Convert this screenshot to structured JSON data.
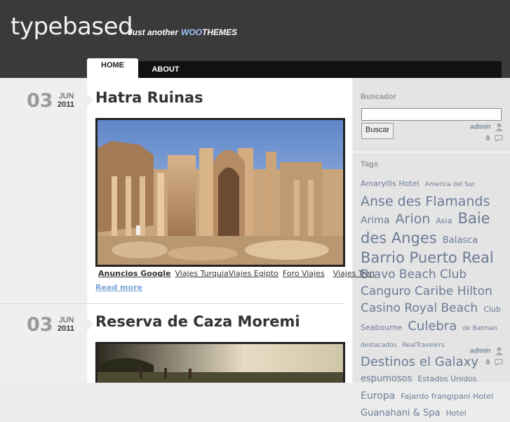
{
  "header": {
    "logo": "typebased",
    "tagline_prefix": "Just another",
    "tagline_brand": "WOO",
    "tagline_suffix": "THEMES"
  },
  "nav": {
    "items": [
      {
        "label": "HOME"
      },
      {
        "label": "ABOUT"
      }
    ]
  },
  "posts": [
    {
      "day": "03",
      "month": "JUN",
      "year": "2011",
      "author": "admin",
      "comments": "0",
      "title": "Hatra Ruinas",
      "ads_label": "Anuncios Google",
      "ads": [
        "Viajes Turquia",
        "Viajes Egipto",
        "Foro Viajes",
        "Viajes Tren"
      ],
      "read_more": "Read more"
    },
    {
      "day": "03",
      "month": "JUN",
      "year": "2011",
      "author": "admin",
      "comments": "0",
      "title": "Reserva de Caza Moremi"
    }
  ],
  "sidebar": {
    "search_title": "Buscador",
    "search_value": "",
    "search_button": "Buscar",
    "tags_title": "Tags",
    "tags": [
      {
        "label": "Amaryllis Hotel",
        "size": 11
      },
      {
        "label": "America del Sur",
        "size": 9
      },
      {
        "label": "Anse des Flamands",
        "size": 19
      },
      {
        "label": "Arima",
        "size": 14
      },
      {
        "label": "Arion",
        "size": 19
      },
      {
        "label": "Asia",
        "size": 11
      },
      {
        "label": "Baie des Anges",
        "size": 21
      },
      {
        "label": "Balasca",
        "size": 13
      },
      {
        "label": "Barrio Puerto Real",
        "size": 21
      },
      {
        "label": "Bravo Beach Club",
        "size": 17
      },
      {
        "label": "Canguro Caribe Hilton",
        "size": 17
      },
      {
        "label": "Casino Royal Beach",
        "size": 17
      },
      {
        "label": "Club Seabourne",
        "size": 11
      },
      {
        "label": "Culebra",
        "size": 18
      },
      {
        "label": "de Batman destacados",
        "size": 9
      },
      {
        "label": "RealTravelers",
        "size": 9
      },
      {
        "label": "Destinos el Galaxy",
        "size": 18
      },
      {
        "label": "espumosos",
        "size": 13
      },
      {
        "label": "Estados Unidos",
        "size": 11
      },
      {
        "label": "Europa",
        "size": 14
      },
      {
        "label": "Fajardo frangipani Hotel",
        "size": 11
      },
      {
        "label": "Guanahani & Spa",
        "size": 13
      },
      {
        "label": "Hotel",
        "size": 11
      }
    ]
  },
  "colors": {
    "header_bg": "#3a3a3a",
    "nav_bg": "#111111",
    "tag_color": "#6b7c95",
    "date_day": "#9a9a9a"
  }
}
